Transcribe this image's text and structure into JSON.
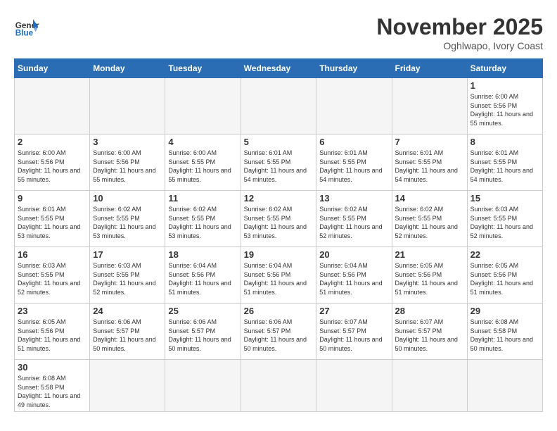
{
  "header": {
    "logo_text_general": "General",
    "logo_text_blue": "Blue",
    "month_title": "November 2025",
    "location": "Oghlwapo, Ivory Coast"
  },
  "weekdays": [
    "Sunday",
    "Monday",
    "Tuesday",
    "Wednesday",
    "Thursday",
    "Friday",
    "Saturday"
  ],
  "weeks": [
    [
      {
        "day": "",
        "info": ""
      },
      {
        "day": "",
        "info": ""
      },
      {
        "day": "",
        "info": ""
      },
      {
        "day": "",
        "info": ""
      },
      {
        "day": "",
        "info": ""
      },
      {
        "day": "",
        "info": ""
      },
      {
        "day": "1",
        "info": "Sunrise: 6:00 AM\nSunset: 5:56 PM\nDaylight: 11 hours\nand 55 minutes."
      }
    ],
    [
      {
        "day": "2",
        "info": "Sunrise: 6:00 AM\nSunset: 5:56 PM\nDaylight: 11 hours\nand 55 minutes."
      },
      {
        "day": "3",
        "info": "Sunrise: 6:00 AM\nSunset: 5:56 PM\nDaylight: 11 hours\nand 55 minutes."
      },
      {
        "day": "4",
        "info": "Sunrise: 6:00 AM\nSunset: 5:55 PM\nDaylight: 11 hours\nand 55 minutes."
      },
      {
        "day": "5",
        "info": "Sunrise: 6:01 AM\nSunset: 5:55 PM\nDaylight: 11 hours\nand 54 minutes."
      },
      {
        "day": "6",
        "info": "Sunrise: 6:01 AM\nSunset: 5:55 PM\nDaylight: 11 hours\nand 54 minutes."
      },
      {
        "day": "7",
        "info": "Sunrise: 6:01 AM\nSunset: 5:55 PM\nDaylight: 11 hours\nand 54 minutes."
      },
      {
        "day": "8",
        "info": "Sunrise: 6:01 AM\nSunset: 5:55 PM\nDaylight: 11 hours\nand 54 minutes."
      }
    ],
    [
      {
        "day": "9",
        "info": "Sunrise: 6:01 AM\nSunset: 5:55 PM\nDaylight: 11 hours\nand 53 minutes."
      },
      {
        "day": "10",
        "info": "Sunrise: 6:02 AM\nSunset: 5:55 PM\nDaylight: 11 hours\nand 53 minutes."
      },
      {
        "day": "11",
        "info": "Sunrise: 6:02 AM\nSunset: 5:55 PM\nDaylight: 11 hours\nand 53 minutes."
      },
      {
        "day": "12",
        "info": "Sunrise: 6:02 AM\nSunset: 5:55 PM\nDaylight: 11 hours\nand 53 minutes."
      },
      {
        "day": "13",
        "info": "Sunrise: 6:02 AM\nSunset: 5:55 PM\nDaylight: 11 hours\nand 52 minutes."
      },
      {
        "day": "14",
        "info": "Sunrise: 6:02 AM\nSunset: 5:55 PM\nDaylight: 11 hours\nand 52 minutes."
      },
      {
        "day": "15",
        "info": "Sunrise: 6:03 AM\nSunset: 5:55 PM\nDaylight: 11 hours\nand 52 minutes."
      }
    ],
    [
      {
        "day": "16",
        "info": "Sunrise: 6:03 AM\nSunset: 5:55 PM\nDaylight: 11 hours\nand 52 minutes."
      },
      {
        "day": "17",
        "info": "Sunrise: 6:03 AM\nSunset: 5:55 PM\nDaylight: 11 hours\nand 52 minutes."
      },
      {
        "day": "18",
        "info": "Sunrise: 6:04 AM\nSunset: 5:56 PM\nDaylight: 11 hours\nand 51 minutes."
      },
      {
        "day": "19",
        "info": "Sunrise: 6:04 AM\nSunset: 5:56 PM\nDaylight: 11 hours\nand 51 minutes."
      },
      {
        "day": "20",
        "info": "Sunrise: 6:04 AM\nSunset: 5:56 PM\nDaylight: 11 hours\nand 51 minutes."
      },
      {
        "day": "21",
        "info": "Sunrise: 6:05 AM\nSunset: 5:56 PM\nDaylight: 11 hours\nand 51 minutes."
      },
      {
        "day": "22",
        "info": "Sunrise: 6:05 AM\nSunset: 5:56 PM\nDaylight: 11 hours\nand 51 minutes."
      }
    ],
    [
      {
        "day": "23",
        "info": "Sunrise: 6:05 AM\nSunset: 5:56 PM\nDaylight: 11 hours\nand 51 minutes."
      },
      {
        "day": "24",
        "info": "Sunrise: 6:06 AM\nSunset: 5:57 PM\nDaylight: 11 hours\nand 50 minutes."
      },
      {
        "day": "25",
        "info": "Sunrise: 6:06 AM\nSunset: 5:57 PM\nDaylight: 11 hours\nand 50 minutes."
      },
      {
        "day": "26",
        "info": "Sunrise: 6:06 AM\nSunset: 5:57 PM\nDaylight: 11 hours\nand 50 minutes."
      },
      {
        "day": "27",
        "info": "Sunrise: 6:07 AM\nSunset: 5:57 PM\nDaylight: 11 hours\nand 50 minutes."
      },
      {
        "day": "28",
        "info": "Sunrise: 6:07 AM\nSunset: 5:57 PM\nDaylight: 11 hours\nand 50 minutes."
      },
      {
        "day": "29",
        "info": "Sunrise: 6:08 AM\nSunset: 5:58 PM\nDaylight: 11 hours\nand 50 minutes."
      }
    ],
    [
      {
        "day": "30",
        "info": "Sunrise: 6:08 AM\nSunset: 5:58 PM\nDaylight: 11 hours\nand 49 minutes."
      },
      {
        "day": "",
        "info": ""
      },
      {
        "day": "",
        "info": ""
      },
      {
        "day": "",
        "info": ""
      },
      {
        "day": "",
        "info": ""
      },
      {
        "day": "",
        "info": ""
      },
      {
        "day": "",
        "info": ""
      }
    ]
  ]
}
